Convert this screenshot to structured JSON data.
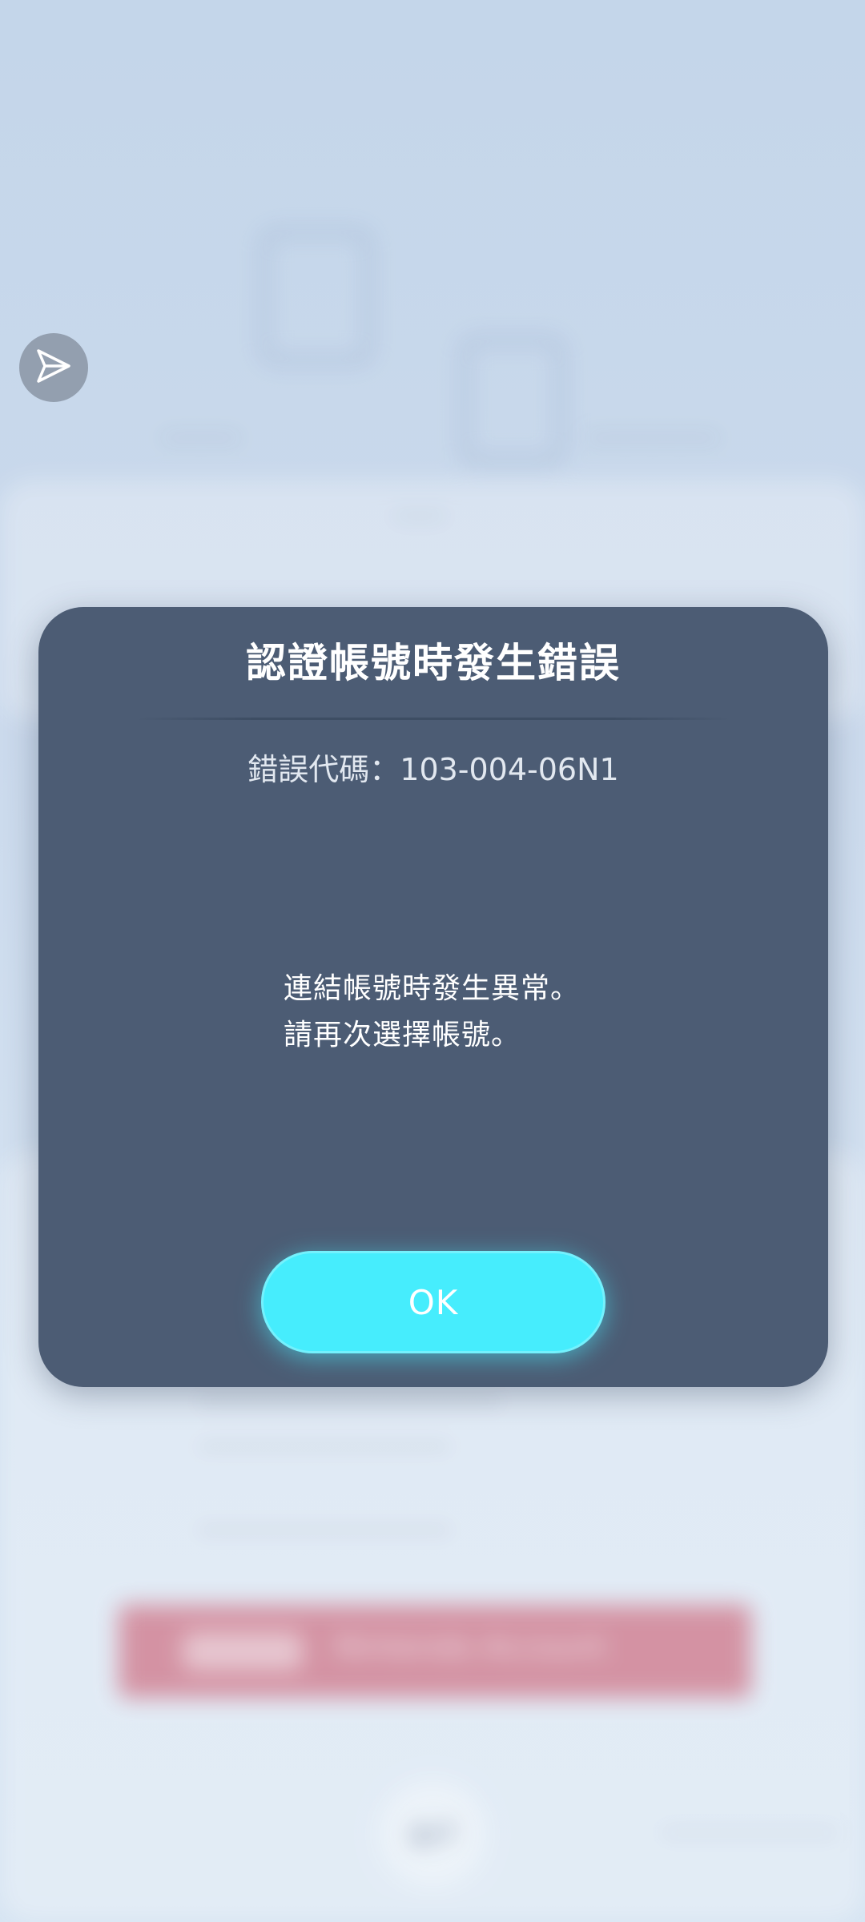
{
  "dialog": {
    "title": "認證帳號時發生錯誤",
    "error_code": "錯誤代碼：103-004-06N1",
    "message_line1": "連結帳號時發生異常。",
    "message_line2": "請再次選擇帳號。",
    "ok_label": "OK"
  },
  "background": {
    "pink_button_label": "Nintendo Account"
  },
  "colors": {
    "dialog_bg": "#4c5c74",
    "ok_button": "#46edfd",
    "pink_button": "#d48596"
  },
  "icons": {
    "floating_bubble": "send-arrow-icon",
    "back_button": "return-arrow-icon"
  }
}
